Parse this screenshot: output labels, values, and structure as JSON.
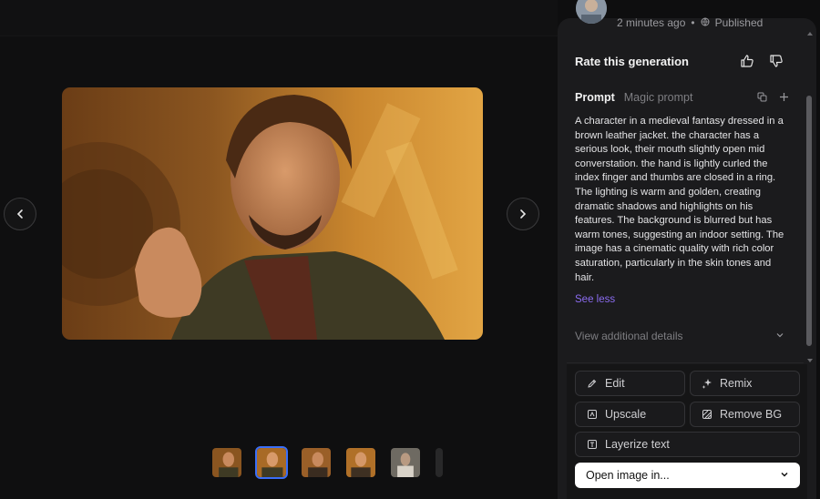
{
  "meta": {
    "time": "2 minutes ago",
    "separator": "•",
    "status": "Published"
  },
  "rating": {
    "title": "Rate this generation",
    "thumbs_up_icon": "thumbs-up-icon",
    "thumbs_down_icon": "thumbs-down-icon"
  },
  "prompt": {
    "tab_prompt": "Prompt",
    "tab_magic": "Magic prompt",
    "text": "A character in a medieval fantasy dressed in a brown leather jacket. the character has a serious look, their mouth slightly open mid converstation. the hand is lightly curled the index finger and thumbs are closed in a ring. The lighting is warm and golden, creating dramatic shadows and highlights on his features. The background is blurred but has warm tones, suggesting an indoor setting. The image has a cinematic quality with rich color saturation, particularly in the skin tones and hair.",
    "see_less": "See less"
  },
  "details": {
    "label": "View additional details"
  },
  "actions": {
    "edit": "Edit",
    "remix": "Remix",
    "upscale": "Upscale",
    "remove_bg": "Remove BG",
    "layerize": "Layerize text",
    "open": "Open image in..."
  },
  "colors": {
    "accent": "#3a6ef7",
    "link": "#8b6cf0",
    "panel": "#1b1b1d",
    "background": "#0f0f10"
  }
}
